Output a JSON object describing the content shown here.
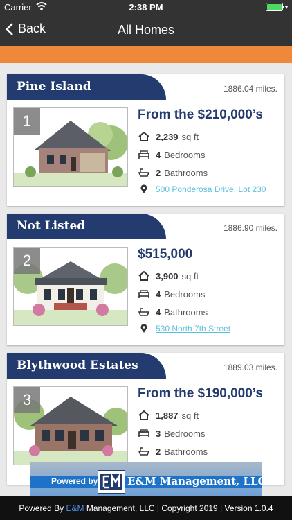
{
  "status_bar": {
    "carrier": "Carrier",
    "time": "2:38 PM"
  },
  "nav": {
    "back_label": "Back",
    "title": "All Homes"
  },
  "homes": [
    {
      "number": "1",
      "name": "Pine Island",
      "distance": "1886.04 miles.",
      "price": "From the $210,000’s",
      "sqft": "2,239",
      "sqft_label": "sq ft",
      "bedrooms": "4",
      "bedrooms_label": "Bedrooms",
      "bathrooms": "2",
      "bathrooms_label": "Bathrooms",
      "address": "500 Ponderosa Drive, Lot 230"
    },
    {
      "number": "2",
      "name": "Not Listed",
      "distance": "1886.90 miles.",
      "price": "$515,000",
      "sqft": "3,900",
      "sqft_label": "sq ft",
      "bedrooms": "4",
      "bedrooms_label": "Bedrooms",
      "bathrooms": "4",
      "bathrooms_label": "Bathrooms",
      "address": "530 North 7th Street"
    },
    {
      "number": "3",
      "name": "Blythwood Estates",
      "distance": "1889.03 miles.",
      "price": "From the $190,000’s",
      "sqft": "1,887",
      "sqft_label": "sq ft",
      "bedrooms": "3",
      "bedrooms_label": "Bedrooms",
      "bathrooms": "2",
      "bathrooms_label": "Bathrooms",
      "address": ""
    }
  ],
  "banner": {
    "powered": "Powered by",
    "company": "E&M Management, LLC"
  },
  "footer": {
    "prefix": "Powered By ",
    "brand": "E&M",
    "suffix": " Management, LLC | Copyright 2019 | Version 1.0.4"
  },
  "colors": {
    "nav": "#333333",
    "accent": "#f0883c",
    "header": "#233b6e",
    "link": "#5bc0de"
  }
}
